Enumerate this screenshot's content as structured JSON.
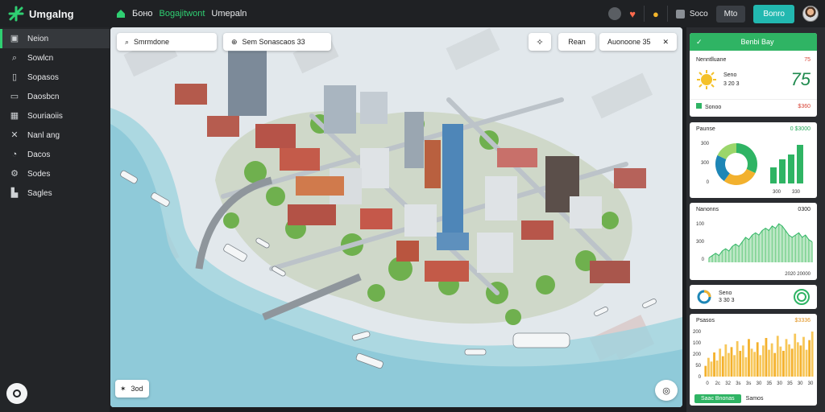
{
  "app": {
    "brand": "Umgalng"
  },
  "topbar": {
    "nav": [
      "Боно",
      "Bogajitwont",
      "Umepaln"
    ],
    "wallet_label": "Soco",
    "btn_dark": "Mto",
    "btn_teal": "Bonro"
  },
  "sidebar": {
    "items": [
      {
        "label": "Neion",
        "icon": "layers-icon"
      },
      {
        "label": "Sowlcn",
        "icon": "search-icon"
      },
      {
        "label": "Sopasos",
        "icon": "book-icon"
      },
      {
        "label": "Daosbcn",
        "icon": "monitor-icon"
      },
      {
        "label": "Souriaoiis",
        "icon": "grid-icon"
      },
      {
        "label": "Nanl ang",
        "icon": "tools-icon"
      },
      {
        "label": "Dacos",
        "icon": "rocket-icon"
      },
      {
        "label": "Sodes",
        "icon": "gear-icon"
      },
      {
        "label": "Sagles",
        "icon": "building-icon"
      }
    ]
  },
  "map": {
    "search_chip": "Smrmdone",
    "filter_chip": "Sem Sonascaos 33",
    "zoom_label": "Rean",
    "location_label": "Auonoone 35",
    "scale_label": "3od"
  },
  "panel": {
    "header": "Benbi Bay",
    "weather": {
      "title": "Nenntlluane",
      "value_red": "75",
      "big": "75",
      "line1": "Seno",
      "line2": "3 20 3"
    },
    "status": {
      "label": "Sonoo",
      "value": "$360"
    },
    "donut_card": {
      "title": "Paunse",
      "value": "0 $3000",
      "ticks": [
        "300",
        "300",
        "0"
      ],
      "bar_labels": [
        "300",
        "330"
      ],
      "colors": [
        "#2fb464",
        "#f2b12e",
        "#1e86b6",
        "#9bd66b"
      ]
    },
    "area_card": {
      "title": "Nanonns",
      "value": "0300",
      "ticks": [
        "100",
        "300",
        "0"
      ],
      "footer": "2020 20000",
      "values": [
        2,
        3,
        4,
        3,
        5,
        6,
        5,
        7,
        8,
        7,
        9,
        11,
        10,
        12,
        13,
        12,
        14,
        15,
        14,
        16,
        15,
        17,
        16,
        14,
        12,
        11,
        12,
        13,
        11,
        12,
        10,
        9
      ]
    },
    "mini_card": {
      "title": "Seno",
      "value": "3 30 3"
    },
    "bar_card": {
      "title": "Psasos",
      "value": "$3336",
      "ticks": [
        "200",
        "100",
        "200",
        "50",
        "0"
      ],
      "xlabels": [
        "0",
        "2c",
        "32",
        "3s",
        "3s",
        "30",
        "35",
        "30",
        "35",
        "30",
        "30"
      ],
      "values": [
        20,
        35,
        28,
        45,
        30,
        52,
        38,
        60,
        44,
        55,
        40,
        66,
        48,
        58,
        36,
        70,
        52,
        46,
        64,
        40,
        58,
        72,
        50,
        62,
        44,
        76,
        56,
        48,
        70,
        60,
        52,
        80,
        64,
        58,
        74,
        50,
        68,
        84
      ],
      "btn_green": "Saac Bnonas",
      "btn_text": "Samos"
    }
  }
}
